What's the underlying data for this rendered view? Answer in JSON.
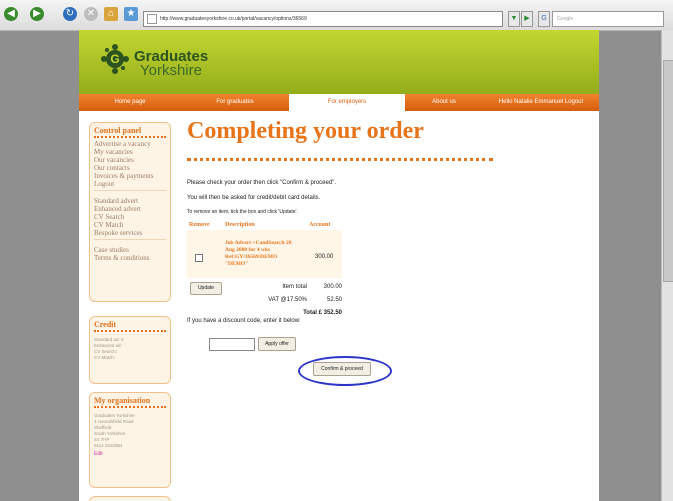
{
  "browser": {
    "url": "http://www.graduatesyorkshire.co.uk/portal/vacancy/options/36569",
    "search_placeholder": "Google"
  },
  "site": {
    "logo_line1": "Graduates",
    "logo_line2": "Yorkshire",
    "nav": [
      "Home page",
      "For graduates",
      "For employers",
      "About us",
      "Hello Natalie Emmanuel Logout"
    ]
  },
  "sidebar": {
    "control_title": "Control panel",
    "group1": [
      "Advertise a vacancy",
      "My vacancies",
      "Our vacancies",
      "Our contacts",
      "Invoices & payments",
      "Logout"
    ],
    "group2": [
      "Standard advert",
      "Enhanced advert",
      "CV Search",
      "CV Match",
      "Bespoke services"
    ],
    "group3": [
      "Case studies",
      "Terms & conditions"
    ],
    "credit_title": "Credit",
    "credit_items": [
      "Standard ad: 0",
      "Enhanced ad:",
      "CV Search:",
      "CV Match:"
    ],
    "org_title": "My organisation",
    "org_lines": [
      "Graduates Yorkshire",
      "4 Houndsfield Road",
      "Sheffield",
      "South Yorkshire",
      "S4 7HP",
      "0114 2220854"
    ],
    "edit_label": "Edit"
  },
  "main": {
    "title": "Completing your order",
    "instr1": "Please check your order then click \"Confirm & proceed\".",
    "instr2": "You will then be asked for credit/debit card details.",
    "instr3": "To remove an item, tick the box and click 'Update'.",
    "col_remove": "Remove",
    "col_description": "Description",
    "col_amount": "Account",
    "item_desc": "Job Advert +CandSearch 20 Aug 2008 for 4 wks Ref:GY/36569/DEMO \"DEMO\"",
    "item_amount": "300.00",
    "update_label": "Update",
    "item_total_label": "Item total",
    "item_total_value": "300.00",
    "vat_label": "VAT @17.50%",
    "vat_value": "52.50",
    "total_text": "Total £ 352.50",
    "discount_prompt": "If you have a discount code, enter it below:",
    "apply_label": "Apply offer",
    "confirm_label": "Confirm & proceed"
  }
}
